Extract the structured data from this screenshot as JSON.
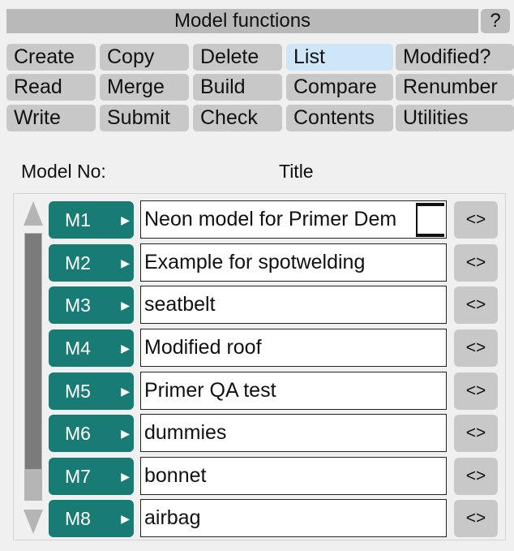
{
  "panel": {
    "title": "Model functions",
    "help_label": "?"
  },
  "functions": {
    "create": "Create",
    "copy": "Copy",
    "delete": "Delete",
    "list": "List",
    "modified": "Modified?",
    "read": "Read",
    "merge": "Merge",
    "build": "Build",
    "compare": "Compare",
    "renumber": "Renumber",
    "write": "Write",
    "submit": "Submit",
    "check": "Check",
    "contents": "Contents",
    "utilities": "Utilities",
    "active": "List"
  },
  "table": {
    "model_no_header": "Model No:",
    "title_header": "Title",
    "swap_label": "<>",
    "rows": [
      {
        "id": "M1",
        "title": "Neon model for Primer Dem"
      },
      {
        "id": "M2",
        "title": "Example for spotwelding"
      },
      {
        "id": "M3",
        "title": "seatbelt"
      },
      {
        "id": "M4",
        "title": "Modified roof"
      },
      {
        "id": "M5",
        "title": "Primer QA test"
      },
      {
        "id": "M6",
        "title": "dummies"
      },
      {
        "id": "M7",
        "title": "bonnet"
      },
      {
        "id": "M8",
        "title": "airbag"
      }
    ]
  },
  "colors": {
    "model_button": "#187b74",
    "active_function": "#cfe6f8",
    "button": "#c8c8c8",
    "title_bar": "#b9b9b9"
  },
  "icons": {
    "model_arrow": "triangle-right-icon",
    "scroll_up": "scroll-up-arrow-icon",
    "scroll_down": "scroll-down-arrow-icon"
  }
}
